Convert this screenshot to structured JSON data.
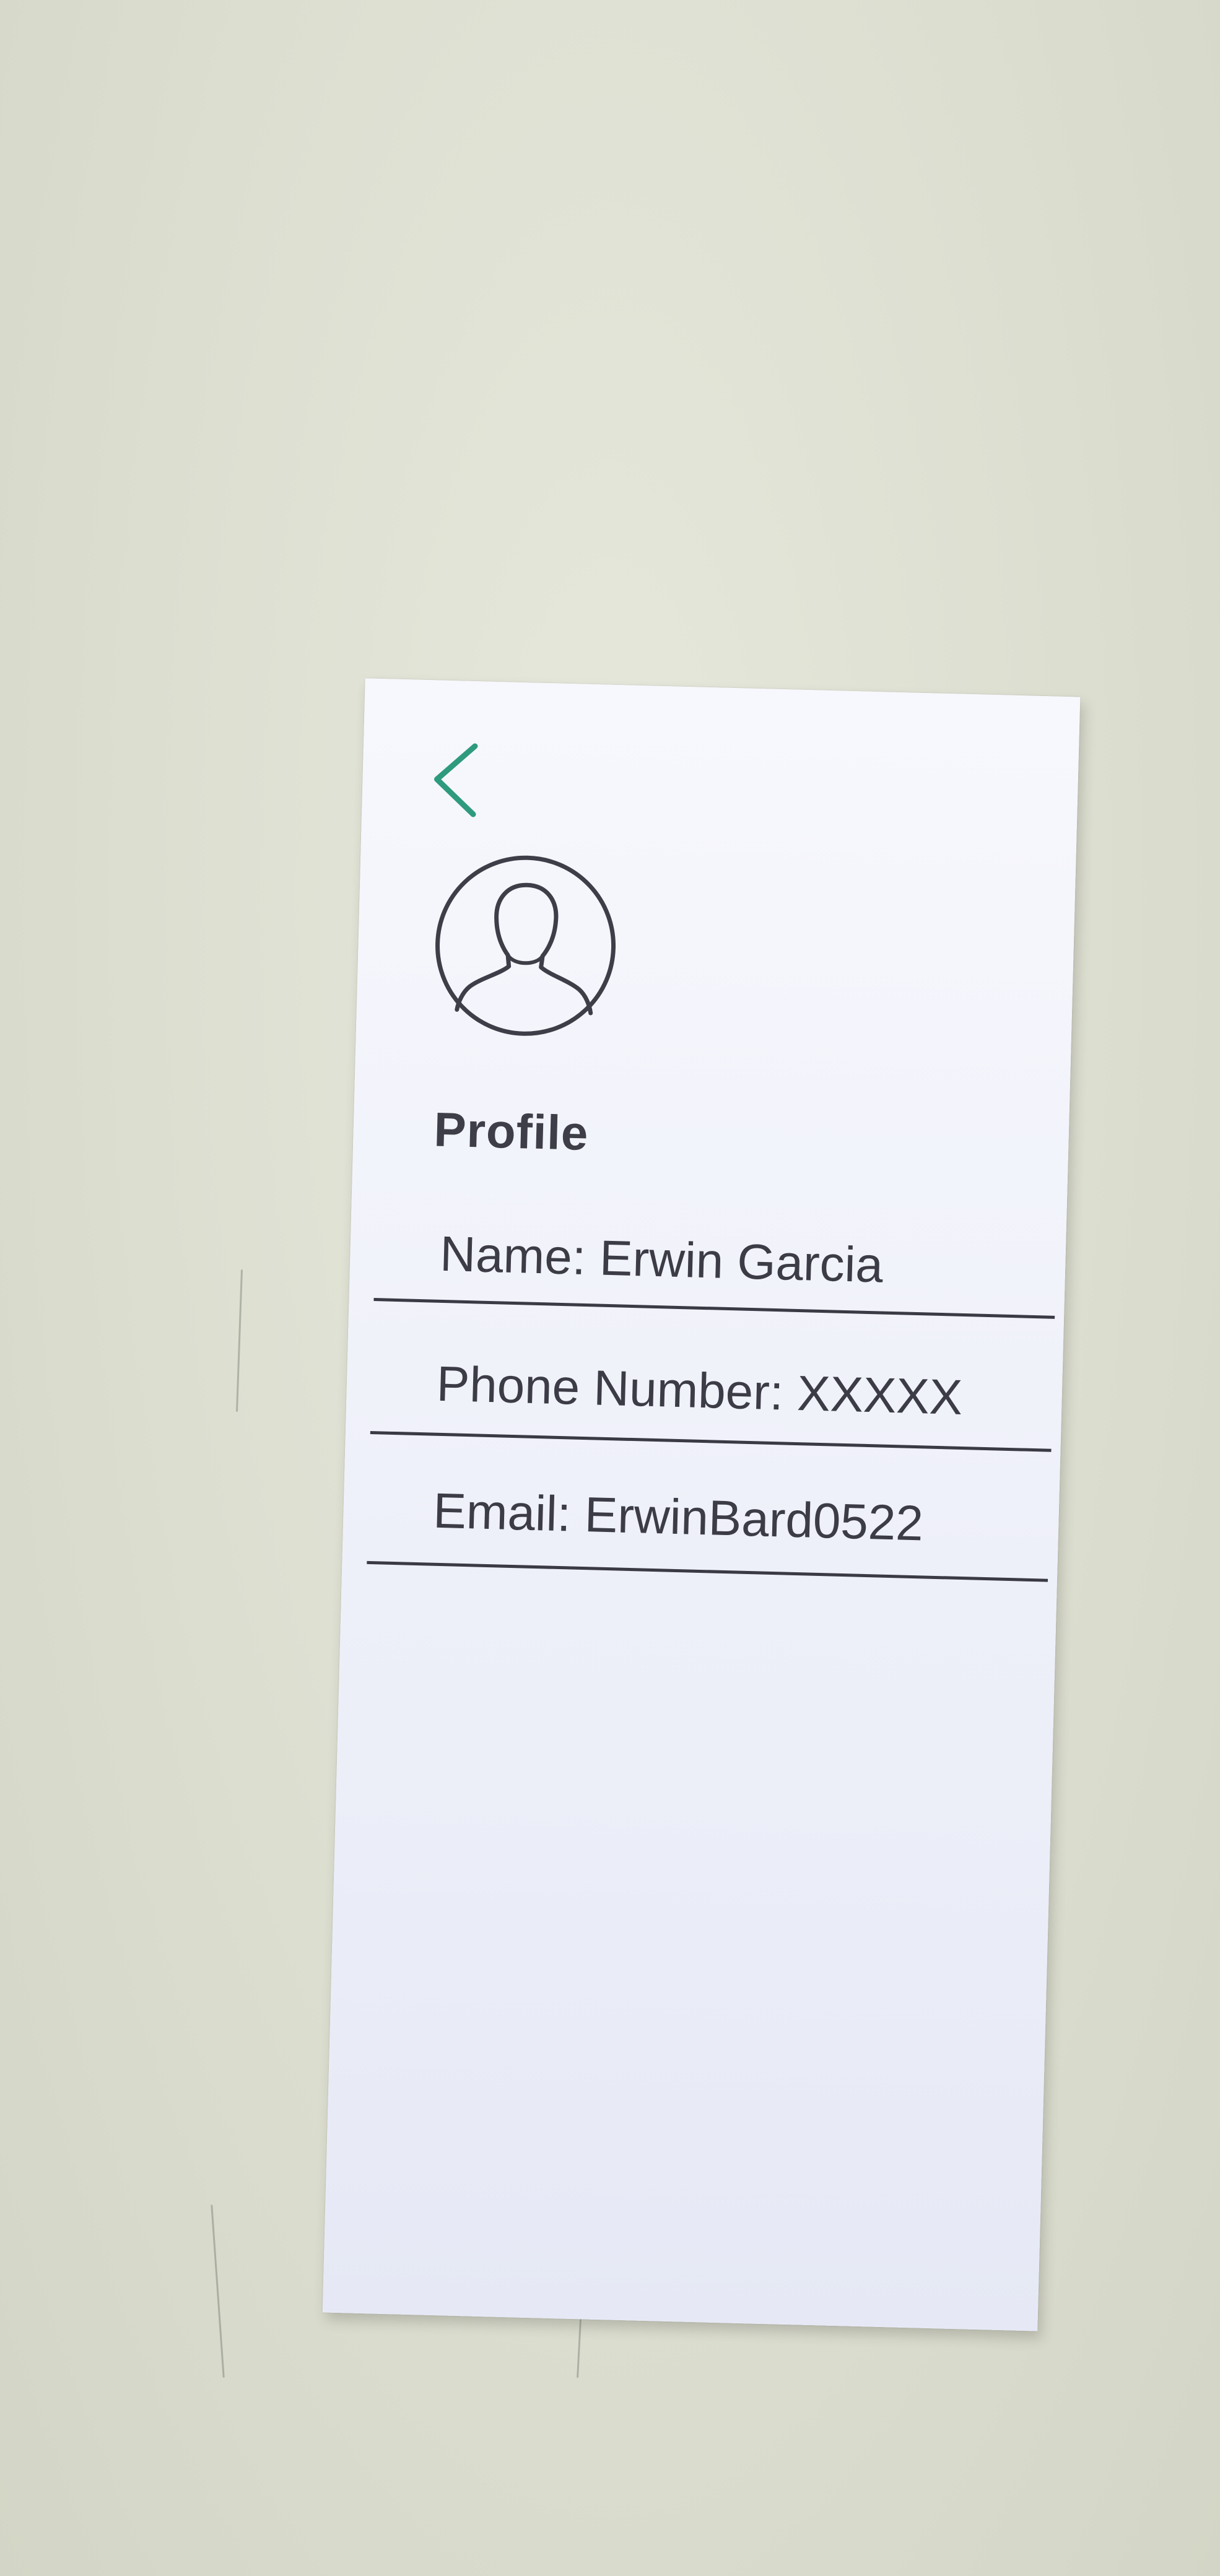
{
  "header": {
    "back_icon": "chevron-left-icon",
    "back_color": "#2e9a7e"
  },
  "profile": {
    "avatar_icon": "user-silhouette-icon",
    "title": "Profile"
  },
  "fields": {
    "name": "Name: Erwin Garcia",
    "phone": "Phone Number: XXXXX",
    "email": "Email: ErwinBard0522"
  },
  "colors": {
    "text": "#3c3c46",
    "paper": "#eef0f9",
    "background": "#dcded0",
    "accent": "#2e9a7e"
  }
}
